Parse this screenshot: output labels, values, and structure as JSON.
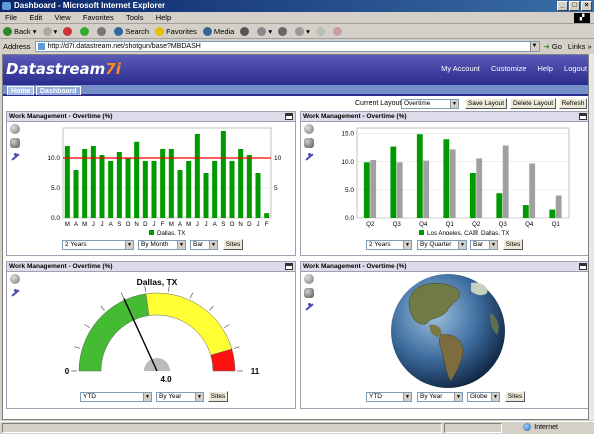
{
  "window": {
    "title": "Dashboard - Microsoft Internet Explorer",
    "btn_min": "_",
    "btn_max": "□",
    "btn_close": "×"
  },
  "menu": [
    "File",
    "Edit",
    "View",
    "Favorites",
    "Tools",
    "Help"
  ],
  "toolbar": {
    "back": "Back",
    "search": "Search",
    "favorites": "Favorites",
    "media": "Media"
  },
  "address": {
    "label": "Address",
    "url": "http://d7i.datastream.net/shotgun/base?MBDASH",
    "go": "Go",
    "links": "Links"
  },
  "app": {
    "logo_text": "Datastream",
    "logo_version": "7i",
    "nav": [
      "My Account",
      "Customize",
      "Help",
      "Logout"
    ]
  },
  "tabs": [
    "Home",
    "Dashboard"
  ],
  "layout": {
    "label": "Current Layout:",
    "value": "Overtime",
    "save": "Save Layout",
    "delete": "Delete Layout",
    "refresh": "Refresh"
  },
  "colors": {
    "bar_green": "#009900",
    "bar_gray": "#a0a0a0",
    "threshold": "#ff0000",
    "gauge_green": "#44bb33",
    "gauge_yellow": "#ffff33",
    "gauge_red": "#ff1111",
    "header_bg": "#2c2c8e"
  },
  "panels": [
    {
      "title": "Work Management - Overtime (%)",
      "controls": {
        "period": "2 Years",
        "group": "By Month",
        "type": "Bar",
        "sites": "Sites"
      }
    },
    {
      "title": "Work Management - Overtime (%)",
      "controls": {
        "period": "2 Years",
        "group": "By Quarter",
        "type": "Bar",
        "sites": "Sites"
      }
    },
    {
      "title": "Work Management - Overtime (%)",
      "controls": {
        "period": "YTD",
        "group": "By Year",
        "sites": "Sites"
      }
    },
    {
      "title": "Work Management - Overtime (%)",
      "controls": {
        "period": "YTD",
        "group": "By Year",
        "type": "Globe",
        "sites": "Sites"
      }
    }
  ],
  "chart_data": [
    {
      "type": "bar",
      "categories": [
        "M",
        "A",
        "M",
        "J",
        "J",
        "A",
        "S",
        "O",
        "N",
        "D",
        "J",
        "F",
        "M",
        "A",
        "M",
        "J",
        "J",
        "A",
        "S",
        "O",
        "N",
        "D",
        "J",
        "F"
      ],
      "series": [
        {
          "name": "Dallas, TX",
          "values": [
            12.0,
            8.0,
            11.5,
            12.0,
            10.5,
            9.5,
            11.0,
            10.0,
            12.7,
            9.5,
            9.5,
            11.5,
            11.5,
            8.0,
            9.5,
            14.0,
            7.5,
            9.5,
            14.5,
            9.5,
            11.5,
            10.5,
            7.5,
            0.8
          ]
        }
      ],
      "threshold": 10,
      "yticks": [
        "0.0",
        "5.0",
        "10.0"
      ],
      "right_ticks": [
        "5",
        "10"
      ],
      "ylim": [
        0,
        15
      ]
    },
    {
      "type": "bar",
      "categories": [
        "Q2",
        "Q3",
        "Q4",
        "Q1",
        "Q2",
        "Q3",
        "Q4",
        "Q1"
      ],
      "series": [
        {
          "name": "Los Angeles, CA",
          "values": [
            9.9,
            12.7,
            14.9,
            14.0,
            8.0,
            4.4,
            2.3,
            1.5
          ]
        },
        {
          "name": "Dallas, TX",
          "values": [
            10.3,
            9.9,
            10.2,
            12.2,
            10.6,
            12.9,
            9.7,
            4.0
          ]
        }
      ],
      "yticks": [
        "0.0",
        "5.0",
        "10.0",
        "15.0"
      ],
      "ylim": [
        0,
        16
      ]
    },
    {
      "type": "gauge",
      "title": "Dallas, TX",
      "value": 4.0,
      "value_label": "4.0",
      "min": 0,
      "max": 11,
      "min_label": "0",
      "max_label": "11",
      "bands": [
        {
          "from": 0,
          "to": 5,
          "color": "green"
        },
        {
          "from": 5,
          "to": 10,
          "color": "yellow"
        },
        {
          "from": 10,
          "to": 11,
          "color": "red"
        }
      ]
    }
  ],
  "status": {
    "zone": "Internet"
  }
}
